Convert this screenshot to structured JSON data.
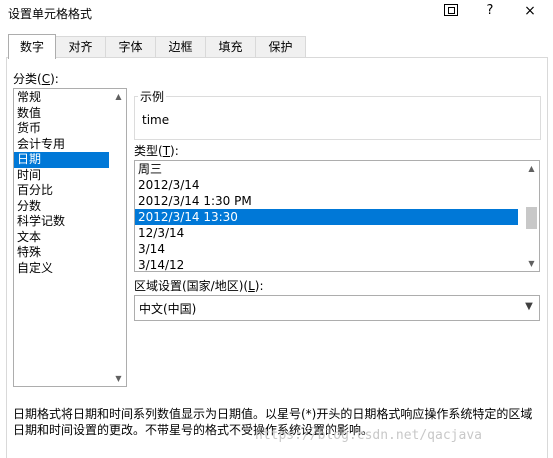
{
  "window": {
    "title": "设置单元格格式",
    "help_label": "?",
    "close_label": "×"
  },
  "tabs": [
    {
      "label": "数字",
      "active": true
    },
    {
      "label": "对齐",
      "active": false
    },
    {
      "label": "字体",
      "active": false
    },
    {
      "label": "边框",
      "active": false
    },
    {
      "label": "填充",
      "active": false
    },
    {
      "label": "保护",
      "active": false
    }
  ],
  "category": {
    "label": "分类(",
    "accel": "C",
    "label_end": "):",
    "items": [
      "常规",
      "数值",
      "货币",
      "会计专用",
      "日期",
      "时间",
      "百分比",
      "分数",
      "科学记数",
      "文本",
      "特殊",
      "自定义"
    ],
    "selected": "日期"
  },
  "sample": {
    "legend": "示例",
    "value": "time"
  },
  "type": {
    "label": "类型(",
    "accel": "T",
    "label_end": "):",
    "items": [
      "周三",
      "2012/3/14",
      "2012/3/14 1:30 PM",
      "2012/3/14 13:30",
      "12/3/14",
      "3/14",
      "3/14/12"
    ],
    "selected": "2012/3/14 13:30"
  },
  "locale": {
    "label": "区域设置(国家/地区)(",
    "accel": "L",
    "label_end": "):",
    "value": "中文(中国)"
  },
  "description": "日期格式将日期和时间系列数值显示为日期值。以星号(*)开头的日期格式响应操作系统特定的区域日期和时间设置的更改。不带星号的格式不受操作系统设置的影响。",
  "watermark": "https://blog.csdn.net/qacjava",
  "colors": {
    "selection": "#0078d7",
    "border": "#adadad"
  }
}
